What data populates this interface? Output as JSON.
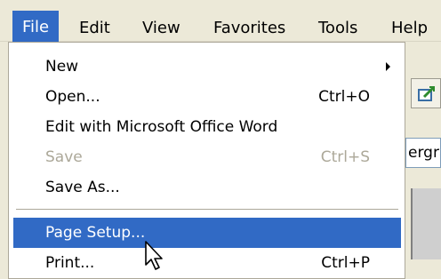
{
  "menubar": {
    "items": [
      {
        "label": "File"
      },
      {
        "label": "Edit"
      },
      {
        "label": "View"
      },
      {
        "label": "Favorites"
      },
      {
        "label": "Tools"
      },
      {
        "label": "Help"
      }
    ]
  },
  "file_menu": {
    "items": [
      {
        "label": "New",
        "shortcut": "",
        "submenu": true,
        "enabled": true
      },
      {
        "label": "Open...",
        "shortcut": "Ctrl+O",
        "enabled": true
      },
      {
        "label": "Edit with Microsoft Office Word",
        "shortcut": "",
        "enabled": true
      },
      {
        "label": "Save",
        "shortcut": "Ctrl+S",
        "enabled": false
      },
      {
        "label": "Save As...",
        "shortcut": "",
        "enabled": true
      },
      {
        "label": "Page Setup...",
        "shortcut": "",
        "enabled": true,
        "highlighted": true
      },
      {
        "label": "Print...",
        "shortcut": "Ctrl+P",
        "enabled": true
      }
    ]
  },
  "background": {
    "address_fragment": "ergra"
  },
  "colors": {
    "highlight": "#316ac5",
    "menu_bg": "#ffffff",
    "chrome": "#ece9d8",
    "disabled_text": "#aca899"
  }
}
